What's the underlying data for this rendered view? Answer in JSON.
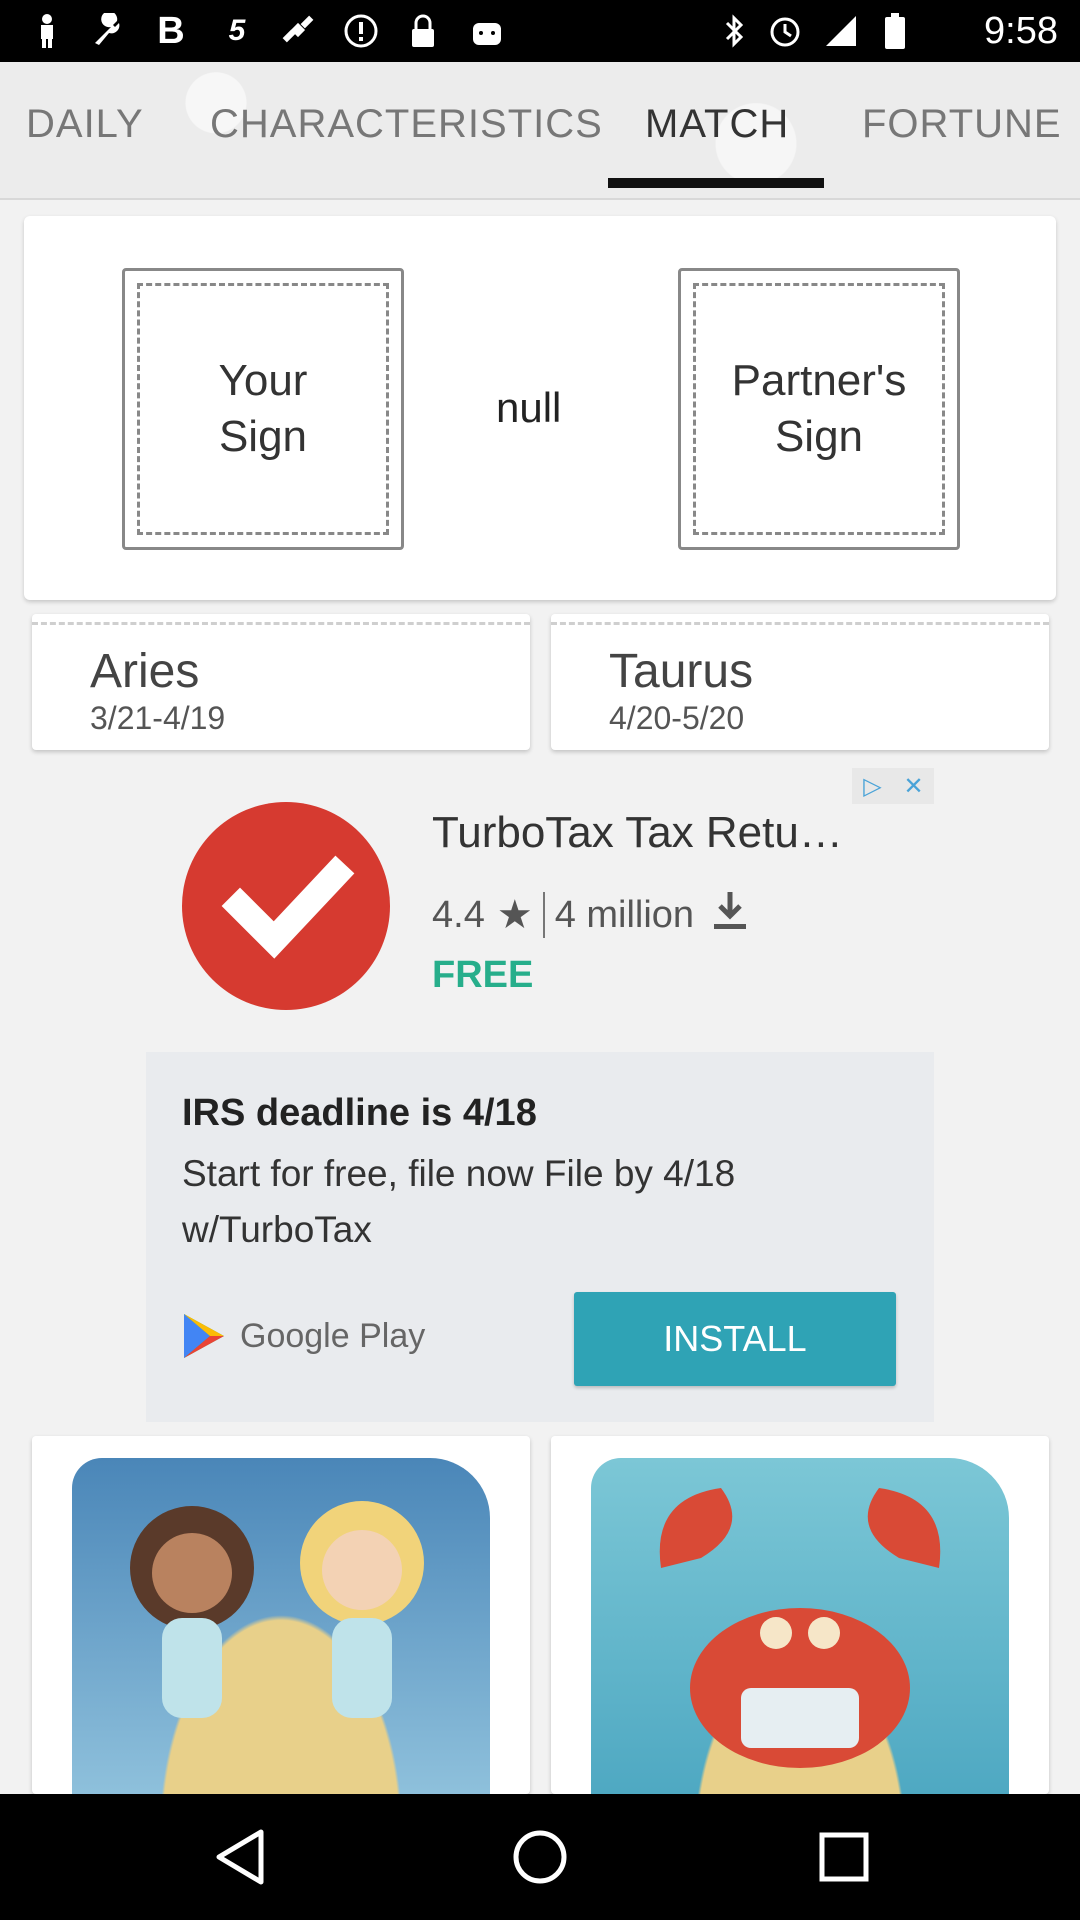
{
  "status_bar": {
    "time": "9:58",
    "icons": [
      "person-icon",
      "wrench-icon",
      "bold-b-icon",
      "sprint-icon",
      "satellite-icon",
      "alert-icon",
      "lock-icon",
      "android-icon",
      "bluetooth-icon",
      "alarm-icon",
      "signal-icon",
      "battery-icon"
    ]
  },
  "tabs": [
    {
      "label": "DAILY"
    },
    {
      "label": "CHARACTERISTICS"
    },
    {
      "label": "MATCH",
      "active": true
    },
    {
      "label": "FORTUNE"
    }
  ],
  "match": {
    "your_sign": "Your\nSign",
    "middle_text": "null",
    "partner_sign": "Partner's\nSign"
  },
  "signs": [
    {
      "name": "Aries",
      "dates": "3/21-4/19"
    },
    {
      "name": "Taurus",
      "dates": "4/20-5/20"
    }
  ],
  "ad": {
    "title": "TurboTax Tax Retu…",
    "rating": "4.4",
    "downloads": "4 million",
    "price": "FREE",
    "headline": "IRS deadline is 4/18",
    "body": "Start for free, file now File by 4/18 w/TurboTax",
    "store": "Google Play",
    "install_label": "INSTALL",
    "logo_color": "#d63a30",
    "button_color": "#2fa3b5"
  },
  "images": [
    {
      "name": "gemini-illustration"
    },
    {
      "name": "cancer-crab-illustration"
    }
  ],
  "nav": [
    "back-icon",
    "home-icon",
    "recents-icon"
  ]
}
